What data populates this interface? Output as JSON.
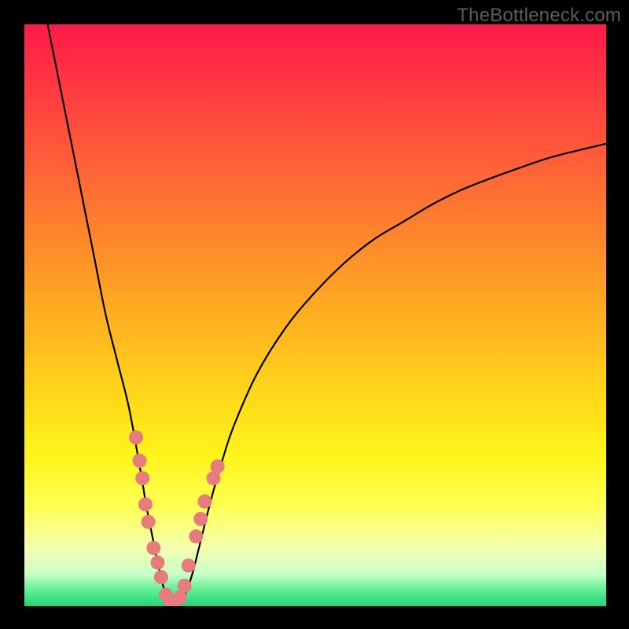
{
  "watermark": "TheBottleneck.com",
  "chart_data": {
    "type": "line",
    "title": "",
    "xlabel": "",
    "ylabel": "",
    "xlim": [
      0,
      100
    ],
    "ylim": [
      0,
      100
    ],
    "grid": false,
    "legend": false,
    "gradient_stops": [
      {
        "offset": 0.0,
        "color": "#ff1a49"
      },
      {
        "offset": 0.22,
        "color": "#ff5a3a"
      },
      {
        "offset": 0.45,
        "color": "#ffa024"
      },
      {
        "offset": 0.62,
        "color": "#ffd21a"
      },
      {
        "offset": 0.74,
        "color": "#fff41a"
      },
      {
        "offset": 0.83,
        "color": "#ffff55"
      },
      {
        "offset": 0.9,
        "color": "#f4ffb0"
      },
      {
        "offset": 0.945,
        "color": "#c8ffc8"
      },
      {
        "offset": 0.97,
        "color": "#66f098"
      },
      {
        "offset": 1.0,
        "color": "#1fd47a"
      }
    ],
    "series": [
      {
        "name": "bottleneck-curve",
        "color": "#000000",
        "x": [
          4,
          6,
          8,
          10,
          12,
          14,
          16,
          18,
          20,
          21,
          22,
          23,
          24,
          25,
          26,
          27,
          28,
          29,
          30,
          32,
          34,
          36,
          40,
          45,
          50,
          55,
          60,
          65,
          70,
          75,
          80,
          85,
          90,
          95,
          100
        ],
        "y": [
          100,
          90,
          80,
          70,
          60,
          50,
          42,
          34,
          23,
          17,
          12,
          7,
          3,
          1,
          0.5,
          1,
          3,
          6,
          10,
          18,
          25,
          31,
          40,
          48,
          54,
          59,
          63,
          66,
          69,
          71.5,
          73.5,
          75.3,
          77,
          78.3,
          79.5
        ]
      }
    ],
    "scatter": {
      "name": "data-points",
      "color": "#e77c7c",
      "radius": 9,
      "points": [
        {
          "x": 19.2,
          "y": 29
        },
        {
          "x": 19.8,
          "y": 25
        },
        {
          "x": 20.3,
          "y": 22
        },
        {
          "x": 20.8,
          "y": 17.5
        },
        {
          "x": 21.3,
          "y": 14.5
        },
        {
          "x": 22.2,
          "y": 10
        },
        {
          "x": 22.9,
          "y": 7.5
        },
        {
          "x": 23.5,
          "y": 5
        },
        {
          "x": 24.3,
          "y": 2
        },
        {
          "x": 25.0,
          "y": 1
        },
        {
          "x": 25.8,
          "y": 0.7
        },
        {
          "x": 26.7,
          "y": 1.5
        },
        {
          "x": 27.5,
          "y": 3.5
        },
        {
          "x": 28.2,
          "y": 7
        },
        {
          "x": 29.5,
          "y": 12
        },
        {
          "x": 30.3,
          "y": 15
        },
        {
          "x": 31.0,
          "y": 18
        },
        {
          "x": 32.5,
          "y": 22
        },
        {
          "x": 33.2,
          "y": 24
        }
      ]
    }
  }
}
